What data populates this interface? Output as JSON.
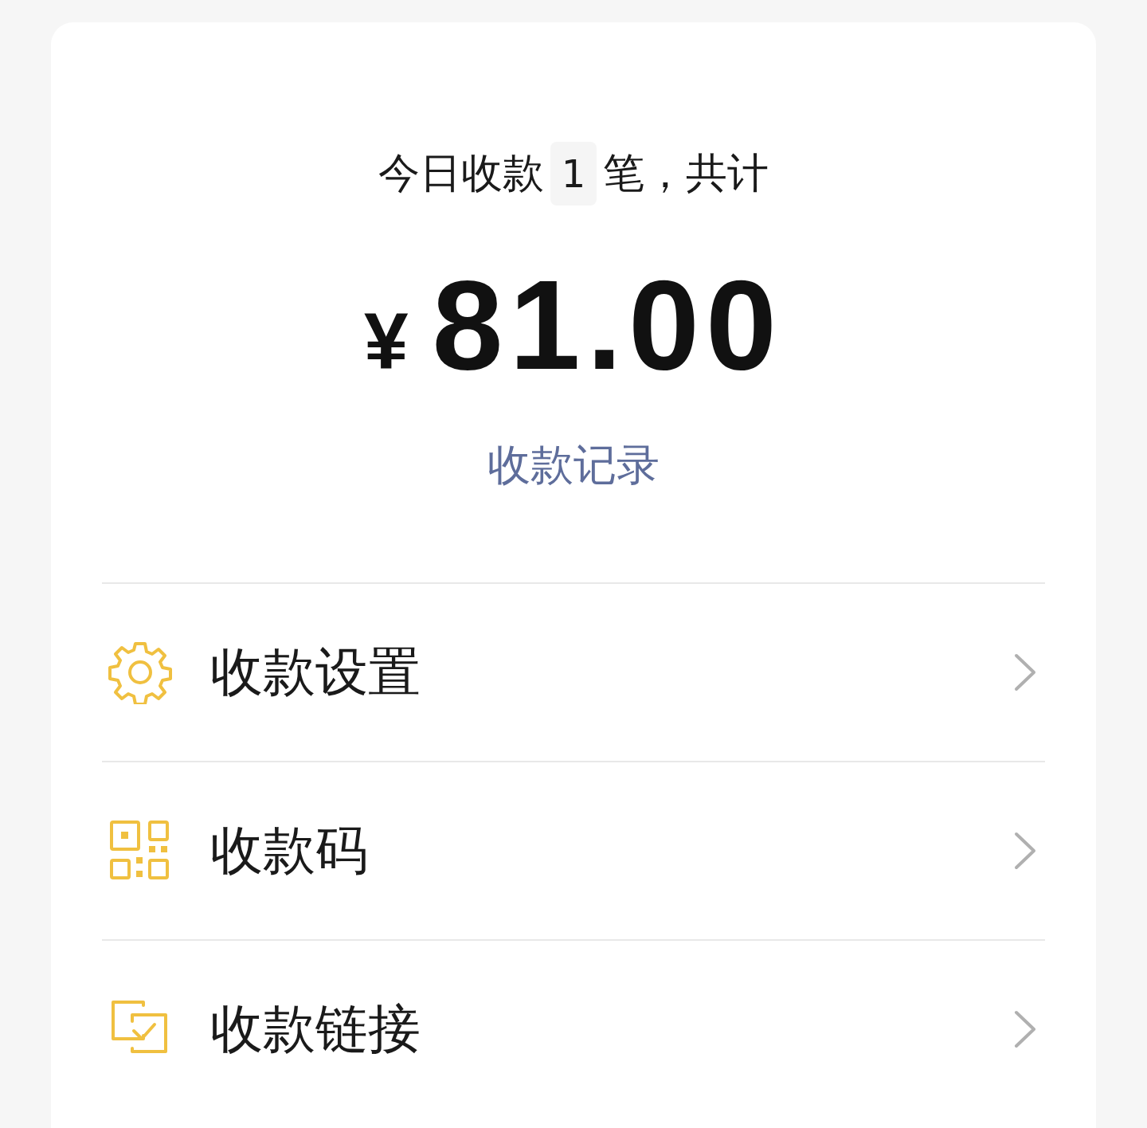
{
  "summary": {
    "prefix": "今日收款",
    "count": "1",
    "suffix": "笔，共计"
  },
  "amount": {
    "currency": "¥",
    "value": "81.00"
  },
  "records_link": "收款记录",
  "menu": [
    {
      "kind": "gear",
      "label": "收款设置"
    },
    {
      "kind": "qr",
      "label": "收款码"
    },
    {
      "kind": "link",
      "label": "收款链接"
    }
  ]
}
